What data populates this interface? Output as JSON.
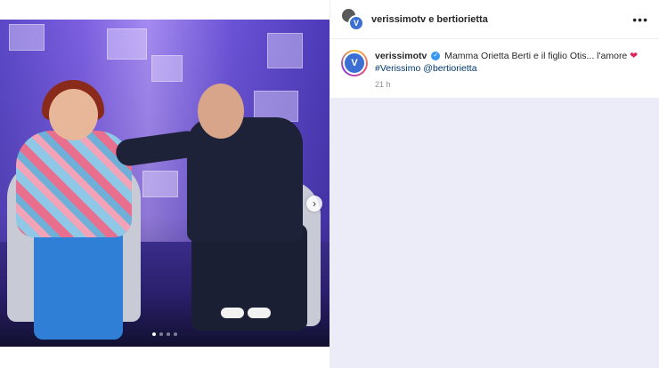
{
  "post": {
    "header": {
      "users": "verissimotv e bertiorietta",
      "more_icon": "more-horizontal-icon",
      "avatar_letter": "V"
    },
    "caption": {
      "username": "verissimotv",
      "verified_icon": "verified-badge-icon",
      "text": "Mamma Orietta Berti e il figlio Otis... l'amore",
      "emoji": "❤",
      "hashtag": "#Verissimo",
      "mention": "@bertiorietta",
      "time": "21 h",
      "avatar_letter": "V"
    },
    "carousel": {
      "next_icon": "chevron-right-icon",
      "next_glyph": "›",
      "slide_count": 4,
      "active_index": 0
    }
  },
  "colors": {
    "accent": "#3897f0",
    "link": "#00376b",
    "heart": "#e0245e",
    "background_panel": "#ecebf8"
  }
}
